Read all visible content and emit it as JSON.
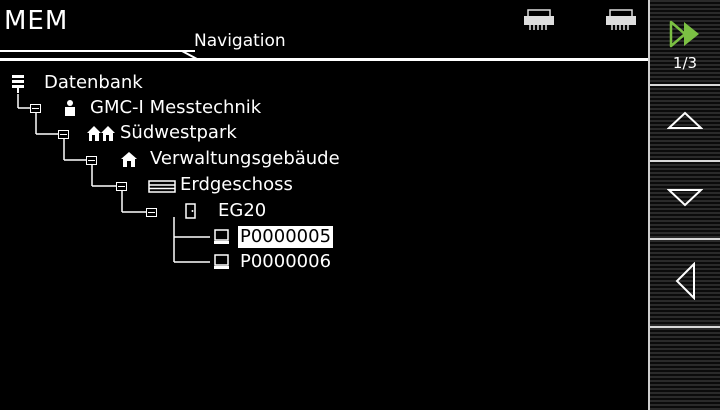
{
  "header": {
    "title": "MEM",
    "subtitle": "Navigation"
  },
  "toolbar": {
    "page_indicator": "1/3",
    "accent_color": "#7bc043"
  },
  "tree": {
    "root": "Datenbank",
    "customer": "GMC-I Messtechnik",
    "site": "Südwestpark",
    "building": "Verwaltungsgebäude",
    "floor": "Erdgeschoss",
    "room": "EG20",
    "devices": [
      "P0000005",
      "P0000006"
    ],
    "selected_device": "P0000005"
  }
}
